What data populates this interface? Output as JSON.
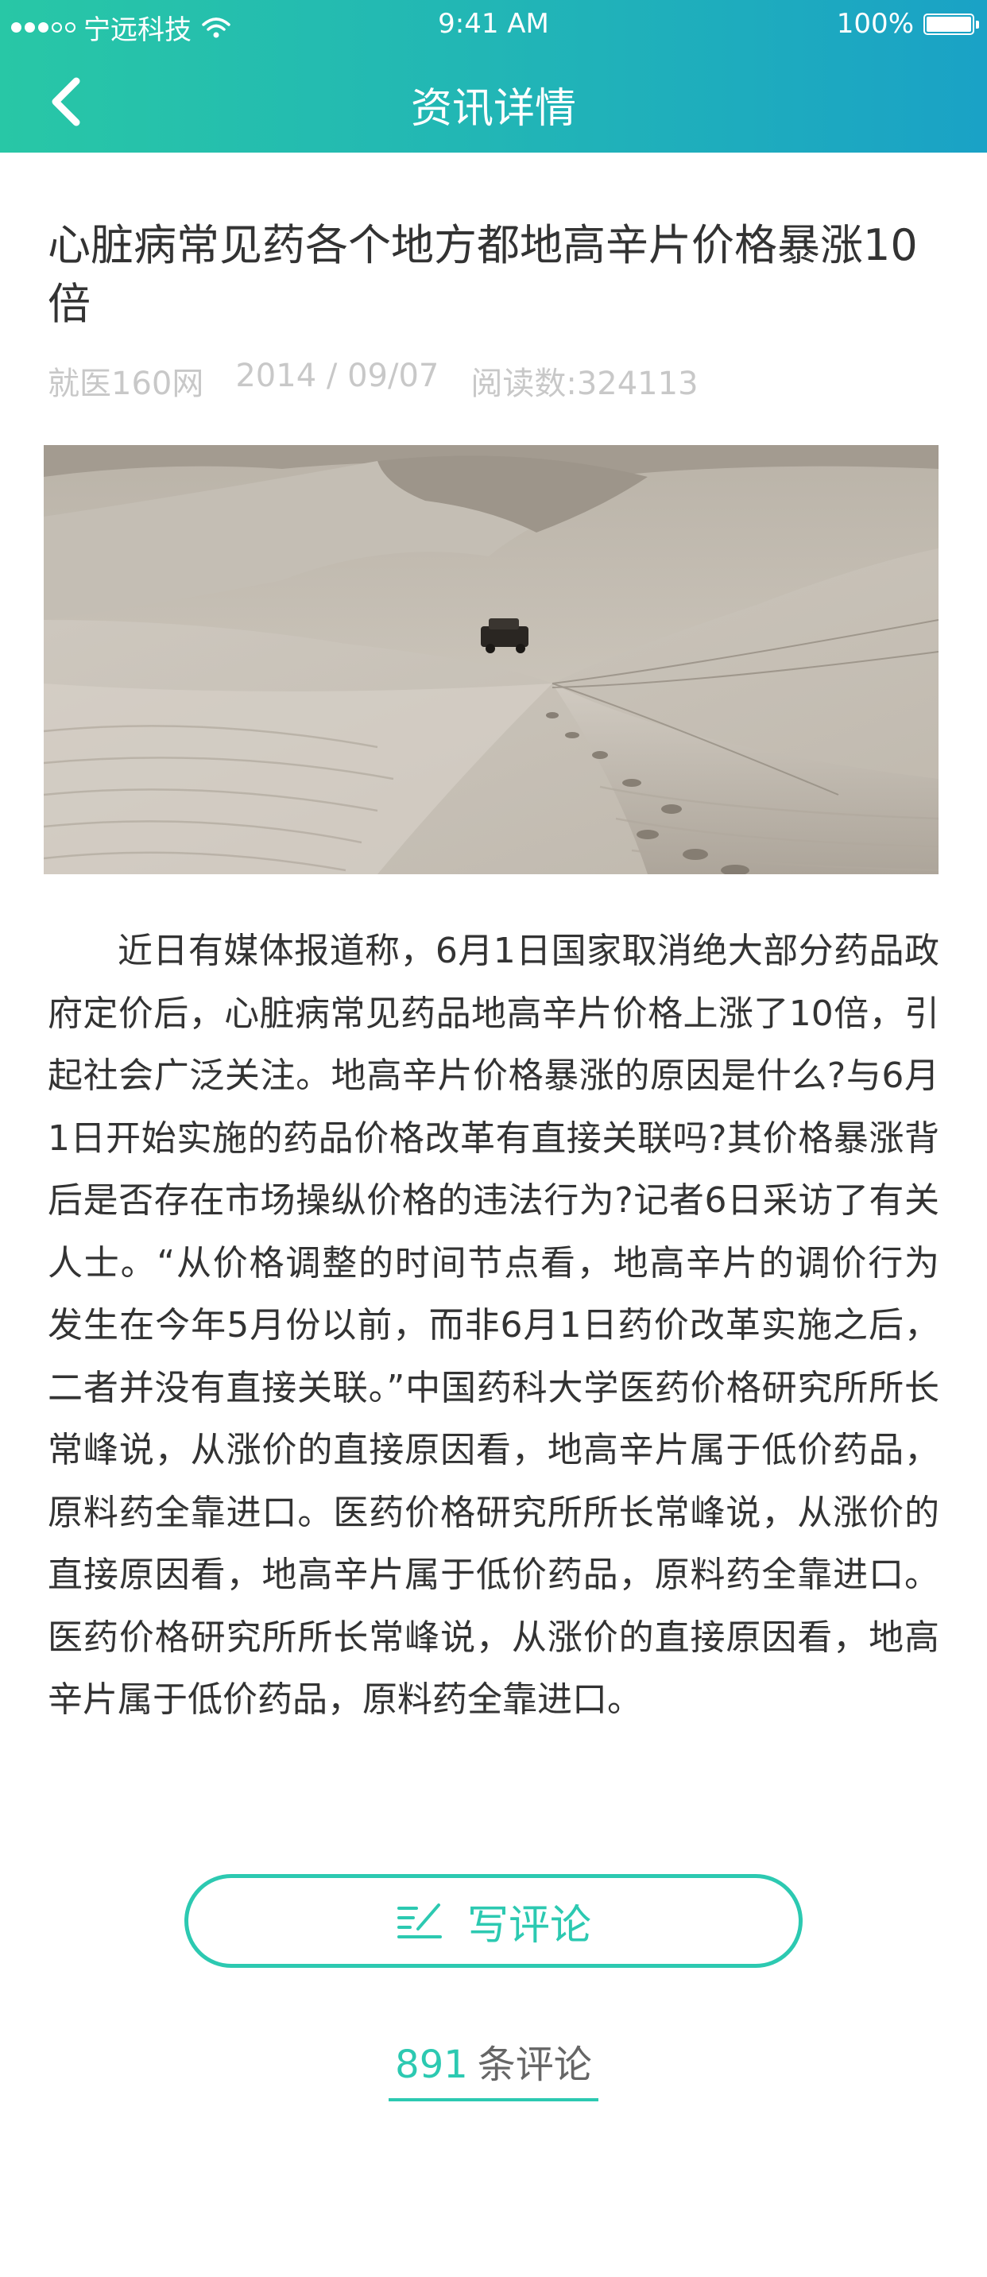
{
  "status_bar": {
    "carrier": "宁远科技",
    "time": "9:41 AM",
    "battery": "100%"
  },
  "nav": {
    "title": "资讯详情"
  },
  "article": {
    "title": "心脏病常见药各个地方都地高辛片价格暴涨10倍",
    "source": "就医160网",
    "date": "2014 / 09/07",
    "reads": "阅读数:324113",
    "body": "近日有媒体报道称，6月1日国家取消绝大部分药品政府定价后，心脏病常见药品地高辛片价格上涨了10倍，引起社会广泛关注。地高辛片价格暴涨的原因是什么?与6月1日开始实施的药品价格改革有直接关联吗?其价格暴涨背后是否存在市场操纵价格的违法行为?记者6日采访了有关人士。“从价格调整的时间节点看，地高辛片的调价行为发生在今年5月份以前，而非6月1日药价改革实施之后，二者并没有直接关联。”中国药科大学医药价格研究所所长常峰说，从涨价的直接原因看，地高辛片属于低价药品，原料药全靠进口。医药价格研究所所长常峰说，从涨价的直接原因看，地高辛片属于低价药品，原料药全靠进口。医药价格研究所所长常峰说，从涨价的直接原因看，地高辛片属于低价药品，原料药全靠进口。"
  },
  "actions": {
    "write_comment": "写评论",
    "comment_count": "891",
    "comment_suffix": "条评论"
  },
  "colors": {
    "accent": "#2cc9b1",
    "header_start": "#28c7a6",
    "header_end": "#1aa2c6"
  },
  "icons": {
    "back": "chevron-left-icon",
    "write": "edit-lines-icon",
    "wifi": "wifi-icon",
    "battery": "battery-icon"
  }
}
